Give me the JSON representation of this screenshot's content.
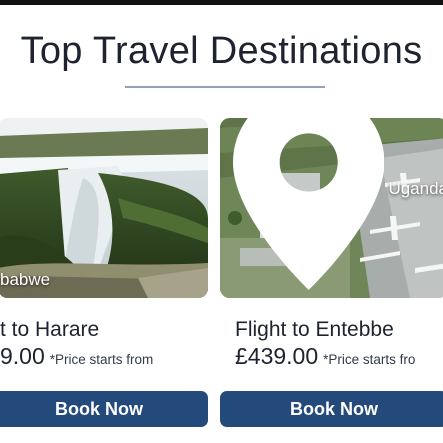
{
  "section": {
    "title": "Top Travel Destinations"
  },
  "cards": [
    {
      "location": "babwe",
      "title": "t to Harare",
      "price": "9.00",
      "price_note": "*Price starts from",
      "button_label": "Book Now"
    },
    {
      "location": "Uganda",
      "title": "Flight to Entebbe",
      "price": "£439.00",
      "price_note": "*Price starts fro",
      "button_label": "Book Now"
    }
  ],
  "colors": {
    "button": "#234a7a",
    "title_text": "#1f2330",
    "underline": "#8ea3b8"
  },
  "icons": {
    "location": "map-pin-icon"
  }
}
